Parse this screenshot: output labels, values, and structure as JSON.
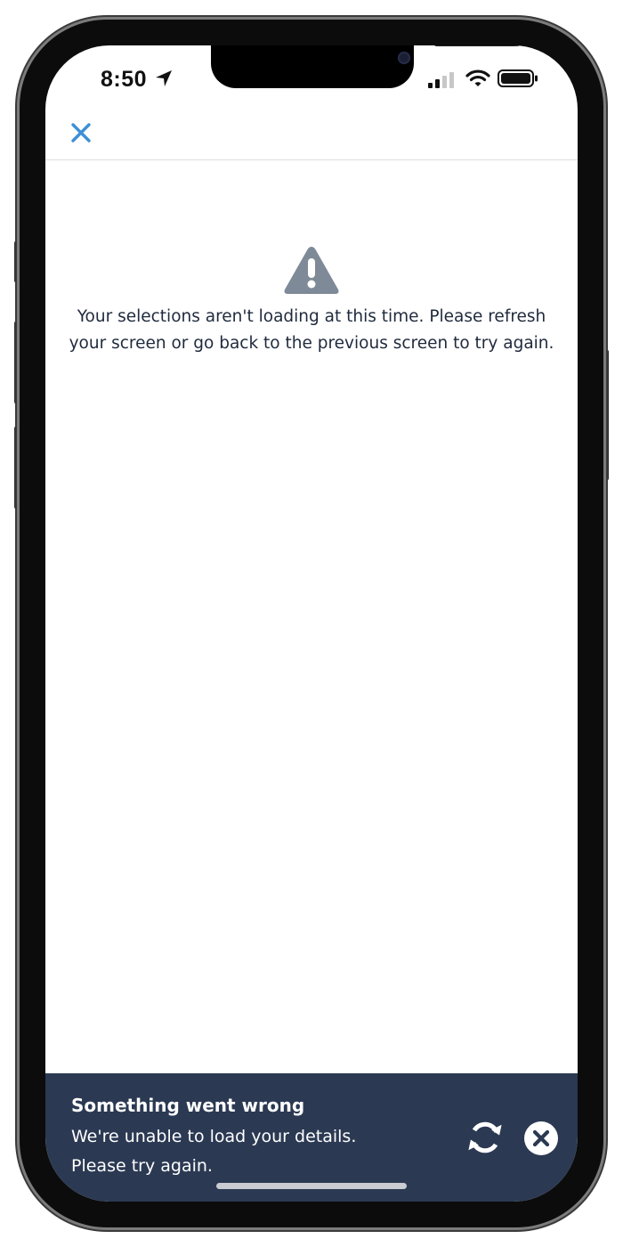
{
  "status_bar": {
    "time": "8:50",
    "icons": [
      "location-arrow-icon",
      "cellular-signal-icon",
      "wifi-icon",
      "battery-icon"
    ]
  },
  "nav": {
    "close_icon": "close-icon"
  },
  "content": {
    "warning_icon": "warning-triangle-icon",
    "message": "Your selections aren't loading at this time. Please refresh your screen or go back to the previous screen to try again."
  },
  "toast": {
    "title": "Something went wrong",
    "line1": "We're unable to load your details.",
    "line2": "Please try again.",
    "refresh_icon": "refresh-icon",
    "dismiss_icon": "close-circle-icon"
  },
  "colors": {
    "accent": "#3d8fd6",
    "warning_icon": "#7e8a97",
    "text": "#1f2a3d",
    "toast_bg": "#2b3953",
    "divider": "#d9dcdf"
  }
}
